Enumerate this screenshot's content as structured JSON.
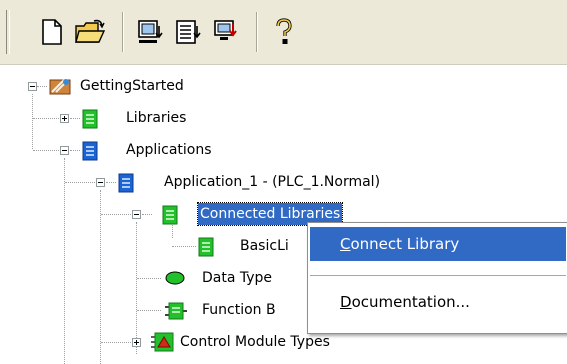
{
  "toolbar": {
    "buttons": [
      {
        "name": "new-icon"
      },
      {
        "name": "open-folder-icon"
      },
      {
        "name": "download-icon"
      },
      {
        "name": "download-all-icon"
      },
      {
        "name": "download-changes-icon"
      },
      {
        "name": "help-icon"
      }
    ]
  },
  "tree": {
    "root": {
      "label": "GettingStarted",
      "icon": "project-icon"
    },
    "libraries": {
      "label": "Libraries",
      "icon": "library-icon"
    },
    "applications": {
      "label": "Applications",
      "icon": "applications-icon"
    },
    "application_1": {
      "label": "Application_1 - (PLC_1.Normal)",
      "icon": "application-icon"
    },
    "connected_libraries": {
      "label": "Connected Libraries",
      "icon": "library-icon",
      "selected": true
    },
    "basic_lib": {
      "label": "BasicLi",
      "icon": "library-icon"
    },
    "data_types": {
      "label": "Data Type",
      "icon": "data-type-icon"
    },
    "function_blocks": {
      "label": "Function B",
      "icon": "function-block-icon"
    },
    "control_module_types": {
      "label": "Control Module Types",
      "icon": "control-module-icon"
    }
  },
  "context_menu": {
    "items": [
      {
        "label": "Connect Library",
        "accel_index": 0,
        "highlighted": true
      },
      {
        "label": "Documentation...",
        "accel_index": 0,
        "highlighted": false
      }
    ]
  },
  "colors": {
    "selection": "#316ac5",
    "toolbar_bg": "#ece9d8",
    "library_green": "#22c02a",
    "application_blue": "#1a64d6"
  }
}
